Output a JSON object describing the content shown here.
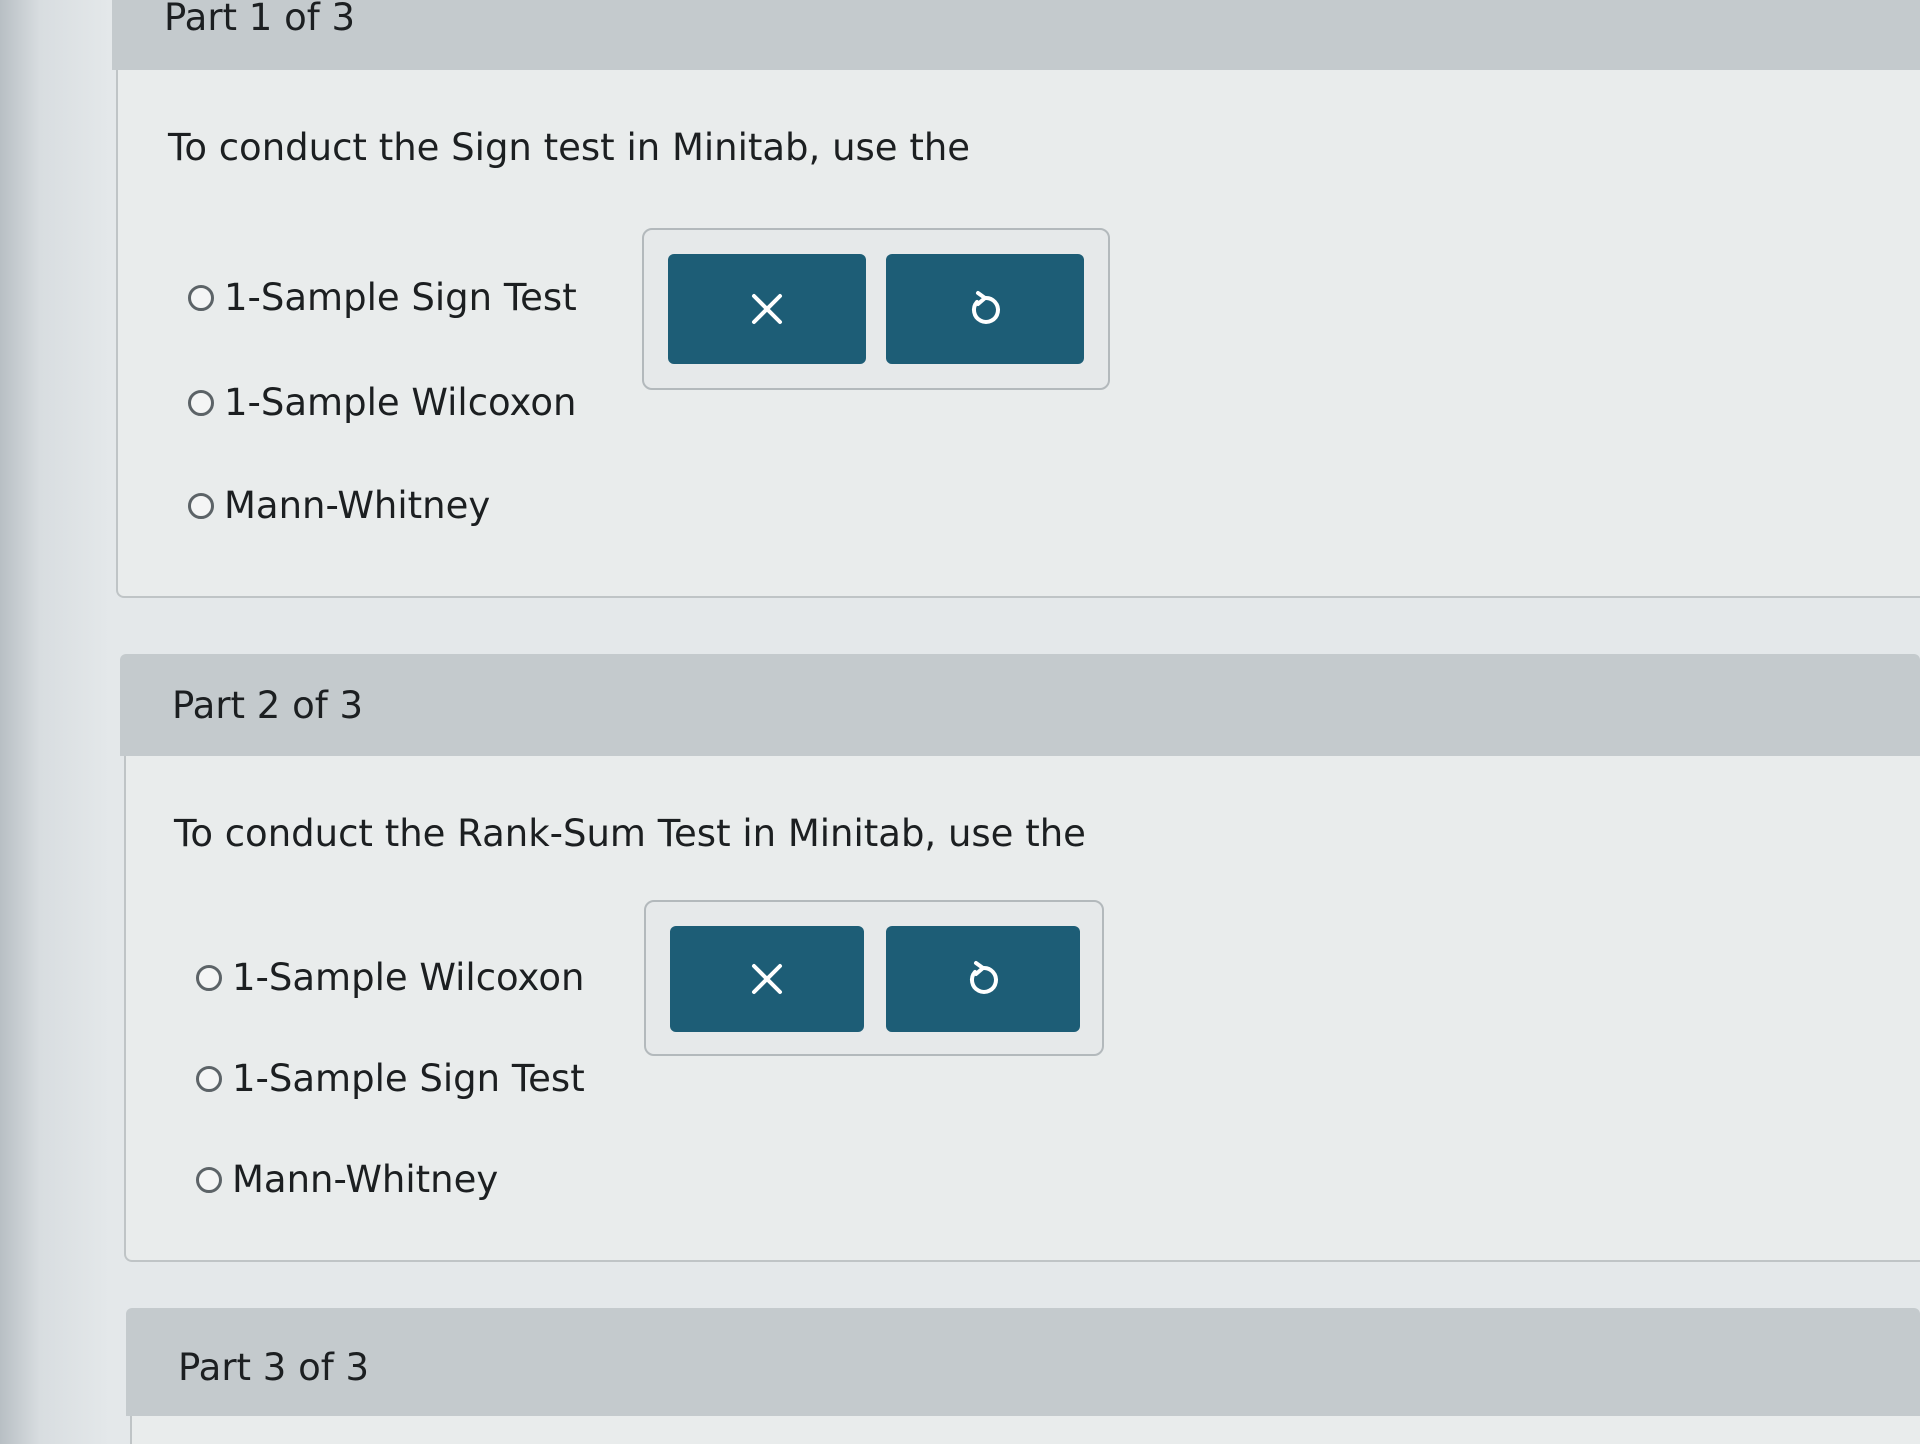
{
  "parts": [
    {
      "title": "Part 1 of 3",
      "question": "To conduct the Sign test in Minitab, use the",
      "options": [
        "1-Sample Sign Test",
        "1-Sample Wilcoxon",
        "Mann-Whitney"
      ],
      "buttons": [
        "close-icon",
        "undo-icon"
      ]
    },
    {
      "title": "Part 2 of 3",
      "question": "To conduct the Rank-Sum Test in Minitab, use the",
      "options": [
        "1-Sample Wilcoxon",
        "1-Sample Sign Test",
        "Mann-Whitney"
      ],
      "buttons": [
        "close-icon",
        "undo-icon"
      ]
    },
    {
      "title": "Part 3 of 3"
    }
  ],
  "colors": {
    "button": "#1d5d76",
    "header": "#c4cacd",
    "body": "#e9ecec"
  }
}
